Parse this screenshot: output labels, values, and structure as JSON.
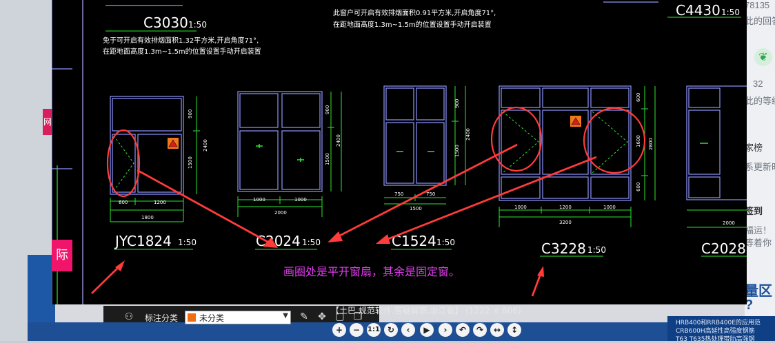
{
  "background_page": {
    "right_texts": [
      "78135",
      "此的回答",
      "32",
      "此的等级",
      "家榜",
      "系更新时",
      "签到",
      "福运！",
      "等着你",
      "量区",
      "?"
    ],
    "left_badge": "际",
    "bottom_right_links": [
      "HRB400和RRB400E的应用范",
      "CRB600H高延性高强度钢筋",
      "T63 T635热处理带肋高强钢"
    ]
  },
  "viewer": {
    "caption": "【土巴.规范软件.答疑解惑.浙江省】 (1222 × 606)",
    "tag_label": "标注分类",
    "tag_value": "未分类",
    "controls": [
      "+",
      "−",
      "1:1",
      "↻",
      "‹",
      "▶",
      "›",
      "↶",
      "↷",
      "↔",
      "↕"
    ]
  },
  "drawing": {
    "notes": {
      "c3030_note_line1": "免于可开启有效排烟面积1.32平方米,开启角度71°,",
      "c3030_note_line2": "在距地面高度1.3m~1.5m的位置设置手动开启装置",
      "top_note_line1": "此窗户可开启有效排烟面积0.91平方米,开启角度71°,",
      "top_note_line2": "在距地面高度1.3m~1.5m的位置设置手动开启装置"
    },
    "top_labels": {
      "c3030": "C3030",
      "c4430": "C4430",
      "scale": "1:50"
    },
    "windows": [
      {
        "name": "JYC1824",
        "scale": "1:50",
        "dims_h": [
          "600",
          "1200"
        ],
        "total": "1800",
        "dims_v": [
          "900",
          "1500"
        ],
        "vtotal": "2400"
      },
      {
        "name": "C2024",
        "scale": "1:50",
        "dims_h": [
          "1000",
          "1000"
        ],
        "total": "2000",
        "dims_v": [
          "900",
          "1500"
        ],
        "vtotal": "2400"
      },
      {
        "name": "C1524",
        "scale": "1:50",
        "dims_h": [
          "750",
          "750"
        ],
        "total": "1500",
        "dims_v": [
          "900",
          "1500"
        ],
        "vtotal": "2400"
      },
      {
        "name": "C3228",
        "scale": "1:50",
        "dims_h": [
          "1000",
          "1200",
          "1000"
        ],
        "total": "3200",
        "dims_v": [
          "600",
          "1600",
          "600"
        ],
        "vtotal": "2800"
      },
      {
        "name": "C2028",
        "scale": "1:50",
        "dims_h": [],
        "total": "2000",
        "dims_v": [],
        "vtotal": ""
      }
    ],
    "annotation": "画圈处是平开窗扇，其余是固定窗。"
  },
  "colors": {
    "frame": "#8f96ff",
    "dim": "#2ee82e",
    "arrow": "#ff3b3b",
    "annotation": "#e23cf0"
  }
}
